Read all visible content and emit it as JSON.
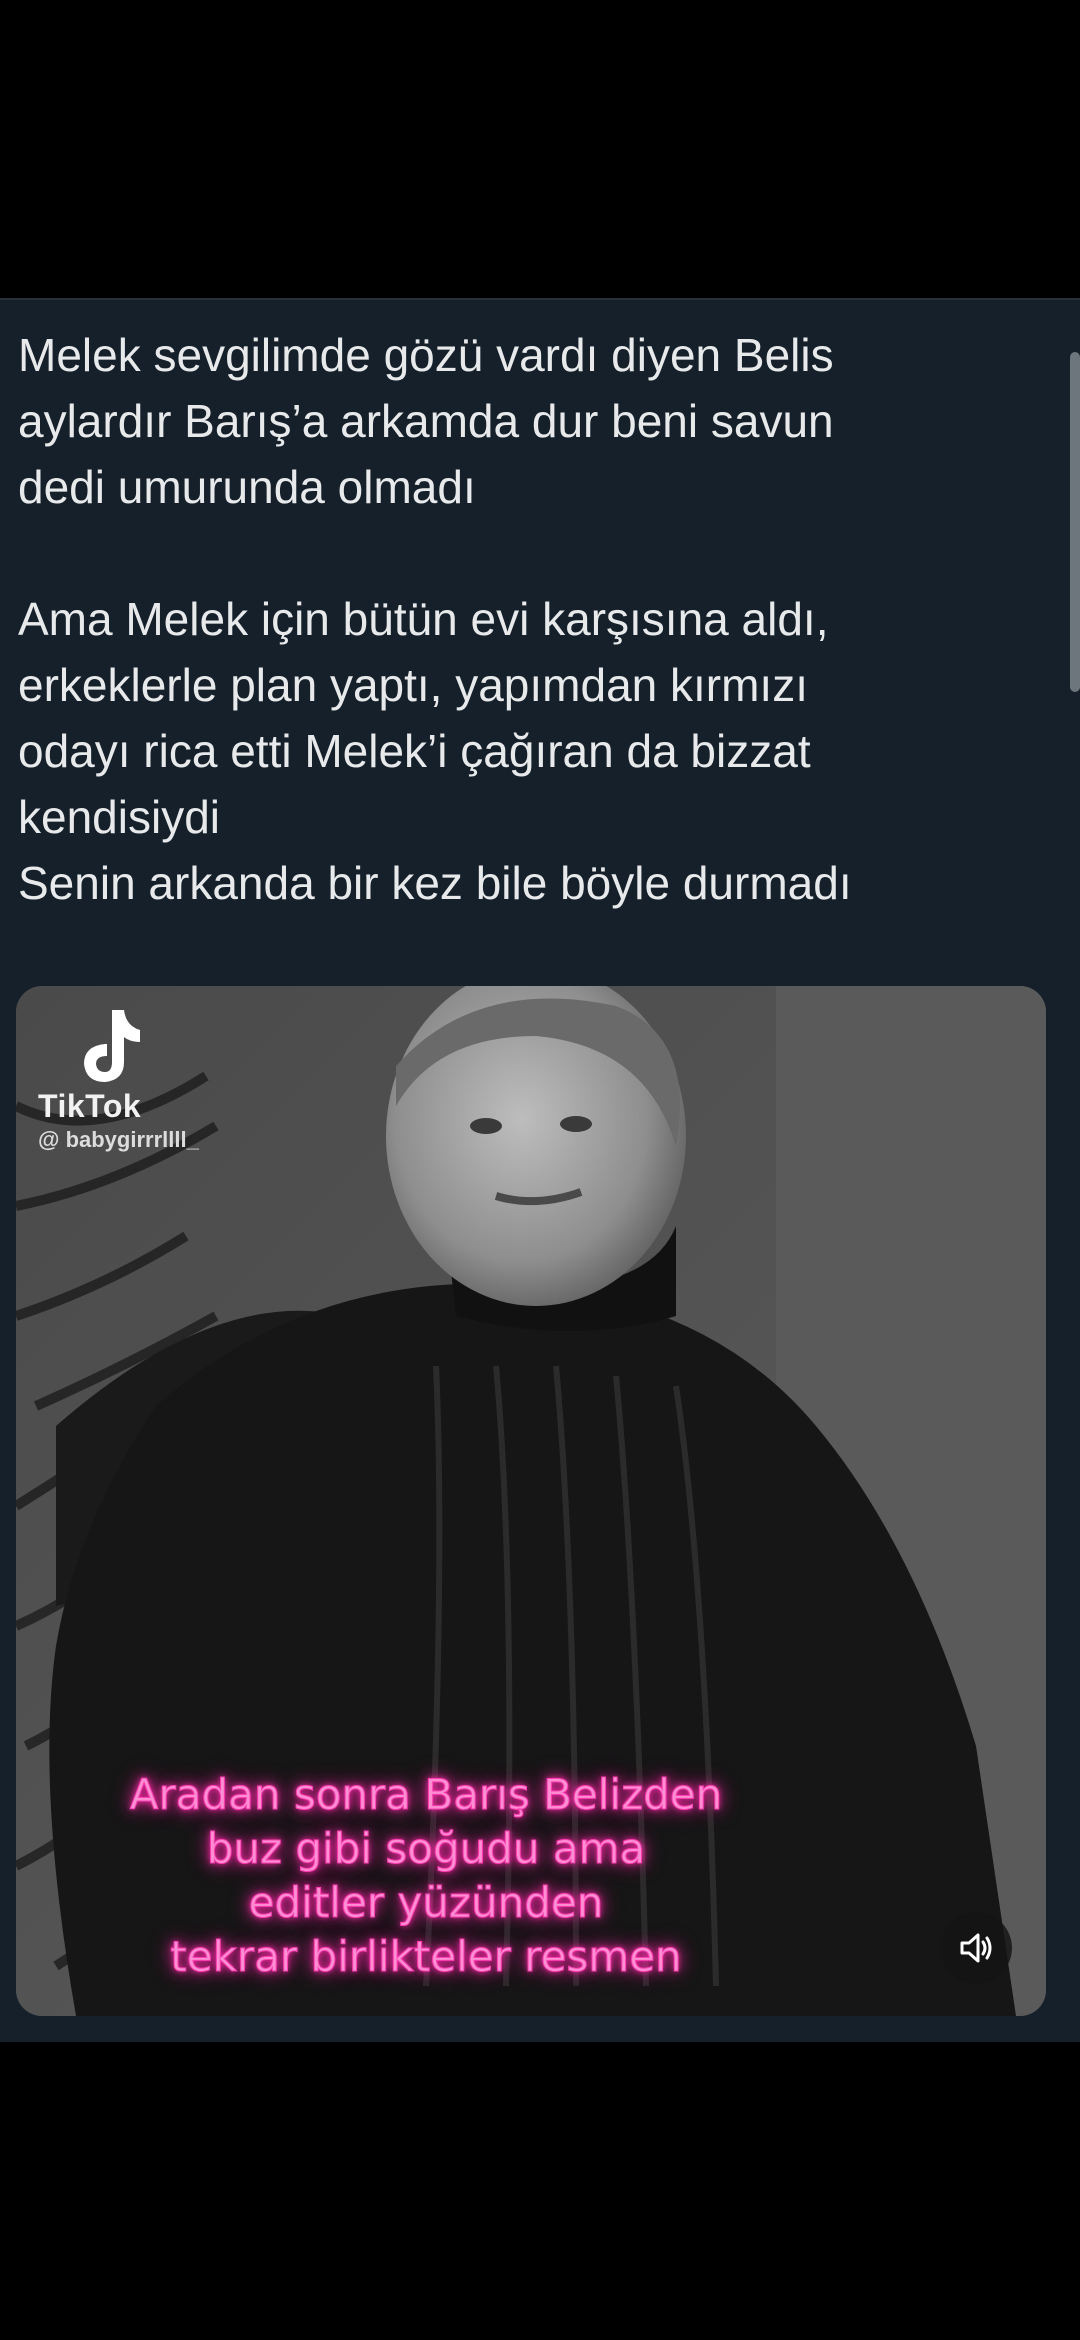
{
  "tweet": {
    "text": "Melek sevgilimde gözü vardı diyen Belis\naylardır Barış’a arkamda dur beni savun\ndedi umurunda olmadı\n\nAma Melek için bütün evi karşısına aldı,\nerkeklerle plan yaptı, yapımdan kırmızı\nodayı rica etti Melek’i çağıran da bizzat\nkendisiydi\nSenin arkanda bir kez bile böyle durmadı"
  },
  "media": {
    "watermark_brand": "TikTok",
    "watermark_user": "@ babygirrrllll_",
    "caption_lines": [
      "Aradan sonra Barış Belizden",
      "buz gibi soğudu ama",
      "editler yüzünden",
      "tekrar birlikteler resmen"
    ],
    "sound_icon": "speaker-muted-icon"
  },
  "colors": {
    "page_background": "#000000",
    "card_background": "#15202b",
    "text": "#e7e9ea",
    "caption_pink": "#ff8fd2"
  }
}
